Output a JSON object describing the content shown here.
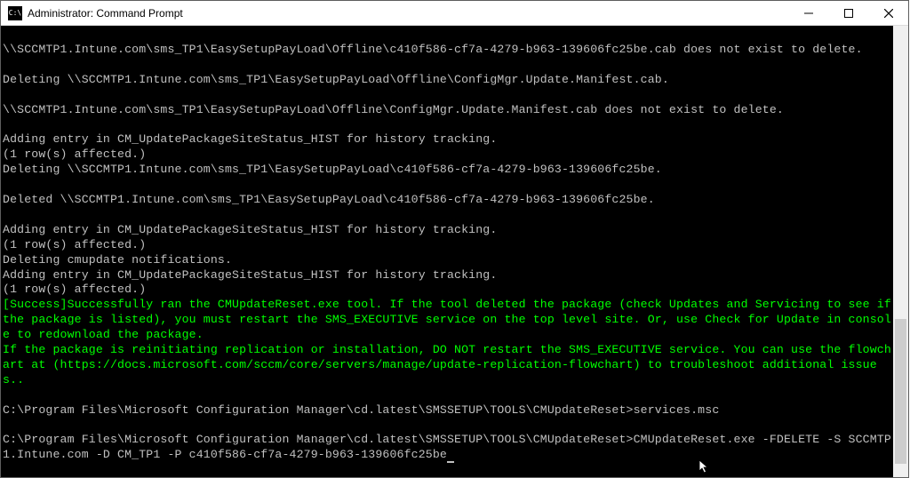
{
  "titlebar": {
    "icon_text": "C:\\",
    "title": "Administrator: Command Prompt"
  },
  "console": {
    "lines": [
      {
        "text": "\\\\SCCMTP1.Intune.com\\sms_TP1\\EasySetupPayLoad\\Offline\\c410f586-cf7a-4279-b963-139606fc25be.cab does not exist to delete.",
        "class": ""
      },
      {
        "text": "",
        "class": ""
      },
      {
        "text": "Deleting \\\\SCCMTP1.Intune.com\\sms_TP1\\EasySetupPayLoad\\Offline\\ConfigMgr.Update.Manifest.cab.",
        "class": ""
      },
      {
        "text": "",
        "class": ""
      },
      {
        "text": "\\\\SCCMTP1.Intune.com\\sms_TP1\\EasySetupPayLoad\\Offline\\ConfigMgr.Update.Manifest.cab does not exist to delete.",
        "class": ""
      },
      {
        "text": "",
        "class": ""
      },
      {
        "text": "Adding entry in CM_UpdatePackageSiteStatus_HIST for history tracking.",
        "class": ""
      },
      {
        "text": "(1 row(s) affected.)",
        "class": ""
      },
      {
        "text": "Deleting \\\\SCCMTP1.Intune.com\\sms_TP1\\EasySetupPayLoad\\c410f586-cf7a-4279-b963-139606fc25be.",
        "class": ""
      },
      {
        "text": "",
        "class": ""
      },
      {
        "text": "Deleted \\\\SCCMTP1.Intune.com\\sms_TP1\\EasySetupPayLoad\\c410f586-cf7a-4279-b963-139606fc25be.",
        "class": ""
      },
      {
        "text": "",
        "class": ""
      },
      {
        "text": "Adding entry in CM_UpdatePackageSiteStatus_HIST for history tracking.",
        "class": ""
      },
      {
        "text": "(1 row(s) affected.)",
        "class": ""
      },
      {
        "text": "Deleting cmupdate notifications.",
        "class": ""
      },
      {
        "text": "Adding entry in CM_UpdatePackageSiteStatus_HIST for history tracking.",
        "class": ""
      },
      {
        "text": "(1 row(s) affected.)",
        "class": ""
      },
      {
        "text": "[Success]Successfully ran the CMUpdateReset.exe tool. If the tool deleted the package (check Updates and Servicing to see if the package is listed), you must restart the SMS_EXECUTIVE service on the top level site. Or, use Check for Update in console to redownload the package.",
        "class": "green"
      },
      {
        "text": "If the package is reinitiating replication or installation, DO NOT restart the SMS_EXECUTIVE service. You can use the flowchart at (https://docs.microsoft.com/sccm/core/servers/manage/update-replication-flowchart) to troubleshoot additional issues..",
        "class": "green"
      },
      {
        "text": "",
        "class": ""
      },
      {
        "text": "C:\\Program Files\\Microsoft Configuration Manager\\cd.latest\\SMSSETUP\\TOOLS\\CMUpdateReset>services.msc",
        "class": ""
      },
      {
        "text": "",
        "class": ""
      },
      {
        "text": "C:\\Program Files\\Microsoft Configuration Manager\\cd.latest\\SMSSETUP\\TOOLS\\CMUpdateReset>CMUpdateReset.exe -FDELETE -S SCCMTP1.Intune.com -D CM_TP1 -P c410f586-cf7a-4279-b963-139606fc25be",
        "class": ""
      }
    ]
  }
}
